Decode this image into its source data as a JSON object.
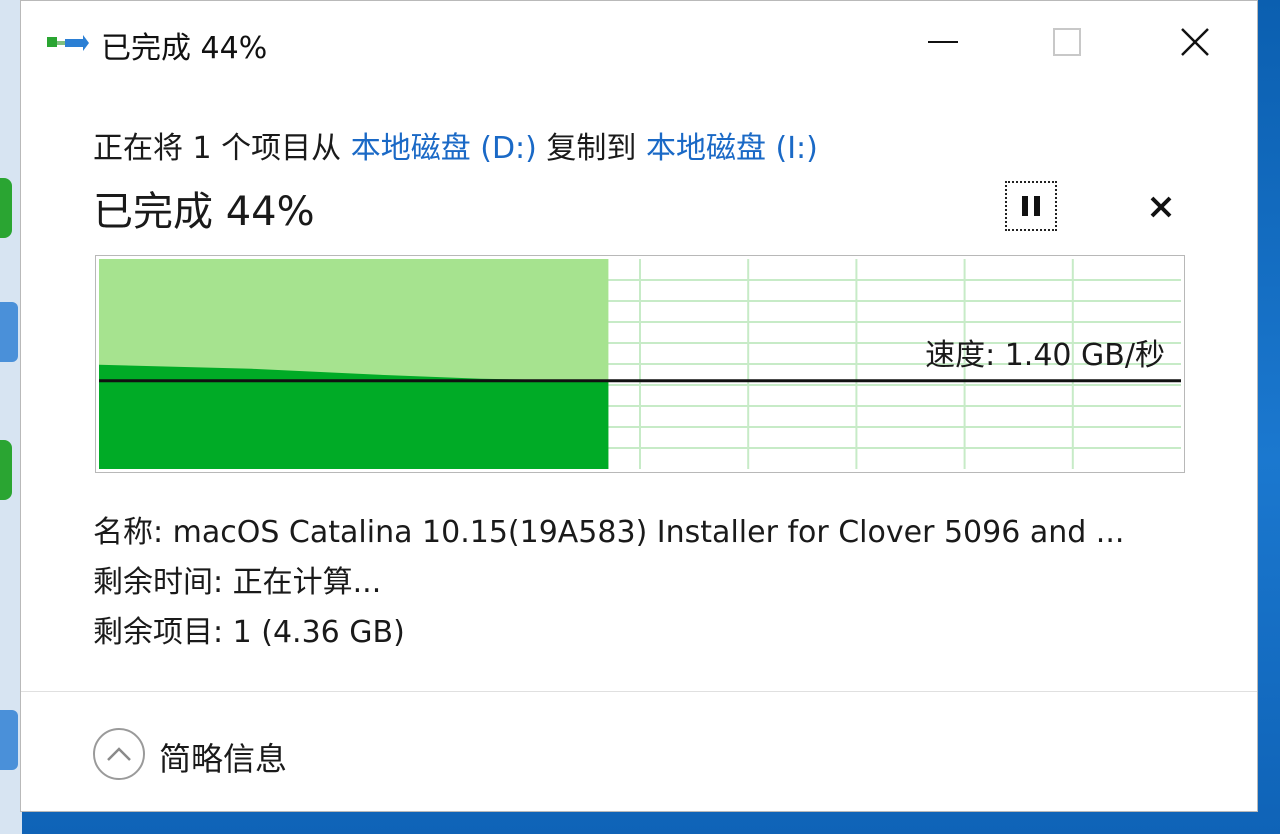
{
  "window": {
    "title": "已完成 44%"
  },
  "copy": {
    "prefix": "正在将 1 个项目从",
    "source": "本地磁盘 (D:)",
    "middle": "复制到",
    "destination": "本地磁盘 (I:)"
  },
  "progress": {
    "title": "已完成 44%",
    "percent": 44,
    "speed": "速度: 1.40 GB/秒",
    "speed_level": 0.42
  },
  "details": {
    "name": "名称: macOS Catalina 10.15(19A583) Installer for Clover 5096 and ...",
    "time_remaining": "剩余时间: 正在计算...",
    "items_remaining": "剩余项目: 1 (4.36 GB)"
  },
  "footer": {
    "label": "简略信息"
  },
  "colors": {
    "accent_link": "#1a69c6",
    "progress_fill": "#a6e38f",
    "speed_fill": "#00ab26",
    "grid": "#c7ebc7"
  },
  "icons": {
    "title": "file-copy-icon",
    "minimize": "minimize-icon",
    "maximize": "maximize-icon",
    "close": "close-icon",
    "pause": "pause-icon",
    "cancel": "cancel-icon",
    "collapse": "chevron-up-icon"
  }
}
